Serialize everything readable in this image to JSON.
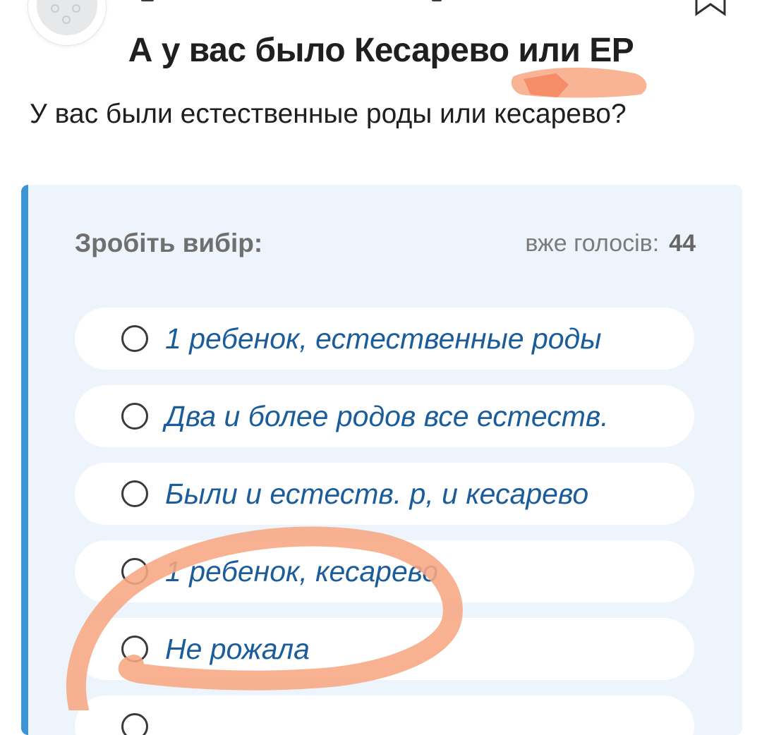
{
  "post": {
    "title": "А у вас было Кесарево или ЕР",
    "question": "У вас были естественные роды или кесарево?"
  },
  "poll": {
    "prompt": "Зробіть вибір:",
    "votes_label": "вже голосів:",
    "votes_count": "44",
    "options": [
      {
        "label": "1 ребенок, естественные роды"
      },
      {
        "label": "Два и более родов все естеств."
      },
      {
        "label": "Были и естеств. р, и кесарево"
      },
      {
        "label": "1 ребенок, кесарево"
      },
      {
        "label": "Не рожала"
      }
    ]
  },
  "icons": {
    "avatar": "avatar-placeholder-icon",
    "bookmark": "bookmark-icon",
    "radio": "radio-unchecked-icon"
  },
  "colors": {
    "accent": "#3d94d5",
    "option_text": "#1b5c9a",
    "poll_background": "#eef4fb",
    "annotation": "#f7a783"
  }
}
